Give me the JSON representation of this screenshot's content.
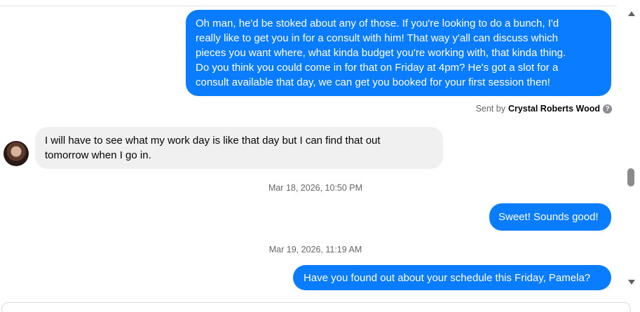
{
  "messages": [
    {
      "direction": "outgoing",
      "text": "Oh man, he'd be stoked about any of those. If you're looking to do a bunch, I'd\nreally like to get you in for a consult with him! That way y'all can discuss which\npieces you want where, what kinda budget you're working with, that kinda thing.\nDo you think you could come in for that on Friday at 4pm? He's got a slot for a\nconsult available that day, we can get you booked for your first session then!"
    },
    {
      "direction": "incoming",
      "text": "I will have to see what my work day is like that day but I can find that out\ntomorrow when I go in."
    },
    {
      "direction": "outgoing",
      "text": "Sweet! Sounds good!"
    },
    {
      "direction": "outgoing",
      "text": "Have you found out about your schedule this Friday, Pamela?"
    }
  ],
  "sent_by": {
    "prefix": "Sent by",
    "name": "Crystal Roberts Wood",
    "help_icon": "question-circle-icon"
  },
  "timestamps": [
    "Mar 18, 2026, 10:50 PM",
    "Mar 19, 2026, 11:19 AM"
  ],
  "colors": {
    "outgoing_bubble": "#0a7cff",
    "incoming_bubble": "#f0f0f0",
    "meta_text": "#65676b"
  }
}
